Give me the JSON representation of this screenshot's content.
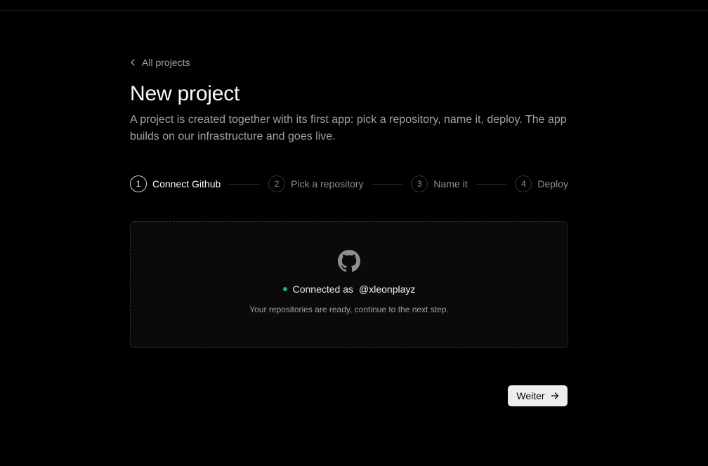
{
  "nav": {
    "back_label": "All projects"
  },
  "header": {
    "title": "New project",
    "description": "A project is created together with its first app: pick a repository, name it, deploy. The app builds on our infrastructure and goes live."
  },
  "steps": [
    {
      "num": "1",
      "label": "Connect Github",
      "active": true
    },
    {
      "num": "2",
      "label": "Pick a repository",
      "active": false
    },
    {
      "num": "3",
      "label": "Name it",
      "active": false
    },
    {
      "num": "4",
      "label": "Deploy",
      "active": false
    }
  ],
  "card": {
    "icon": "github-icon",
    "status_label": "Connected as",
    "username": "@xleonplayz",
    "hint": "Your repositories are ready, continue to the next step.",
    "status_color": "#2ea86b"
  },
  "footer": {
    "next_label": "Weiter",
    "next_icon": "arrow-right-icon"
  }
}
